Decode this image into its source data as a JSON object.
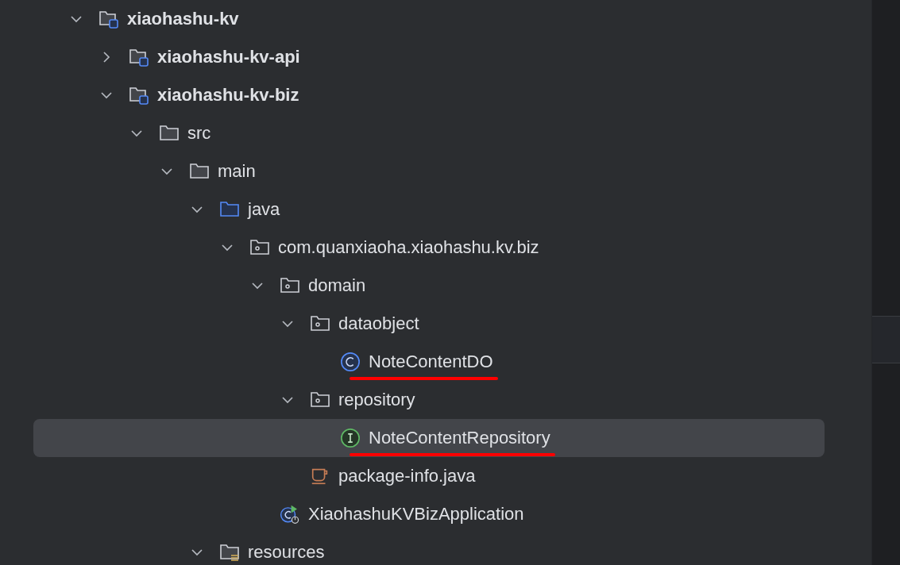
{
  "project_tree": [
    {
      "kind": "module",
      "label": "xiaohashu-kv",
      "expanded": true,
      "selected": false,
      "children": [
        {
          "kind": "module",
          "label": "xiaohashu-kv-api",
          "expanded": false,
          "selected": false
        },
        {
          "kind": "module",
          "label": "xiaohashu-kv-biz",
          "expanded": true,
          "selected": false,
          "children": [
            {
              "kind": "folder",
              "label": "src",
              "expanded": true,
              "selected": false,
              "children": [
                {
                  "kind": "folder",
                  "label": "main",
                  "expanded": true,
                  "selected": false,
                  "children": [
                    {
                      "kind": "source-folder",
                      "label": "java",
                      "expanded": true,
                      "selected": false,
                      "children": [
                        {
                          "kind": "package",
                          "label": "com.quanxiaoha.xiaohashu.kv.biz",
                          "expanded": true,
                          "selected": false,
                          "children": [
                            {
                              "kind": "package",
                              "label": "domain",
                              "expanded": true,
                              "selected": false,
                              "children": [
                                {
                                  "kind": "package",
                                  "label": "dataobject",
                                  "expanded": true,
                                  "selected": false,
                                  "children": [
                                    {
                                      "kind": "class",
                                      "label": "NoteContentDO",
                                      "selected": false,
                                      "underlined": true
                                    }
                                  ]
                                },
                                {
                                  "kind": "package",
                                  "label": "repository",
                                  "expanded": true,
                                  "selected": false,
                                  "children": [
                                    {
                                      "kind": "interface",
                                      "label": "NoteContentRepository",
                                      "selected": true,
                                      "underlined": true
                                    }
                                  ]
                                },
                                {
                                  "kind": "java-file",
                                  "label": "package-info.java",
                                  "selected": false
                                }
                              ]
                            },
                            {
                              "kind": "app-class",
                              "label": "XiaohashuKVBizApplication",
                              "selected": false
                            }
                          ]
                        }
                      ]
                    },
                    {
                      "kind": "resources-folder",
                      "label": "resources",
                      "expanded": true,
                      "selected": false
                    }
                  ]
                }
              ]
            }
          ]
        }
      ]
    }
  ]
}
